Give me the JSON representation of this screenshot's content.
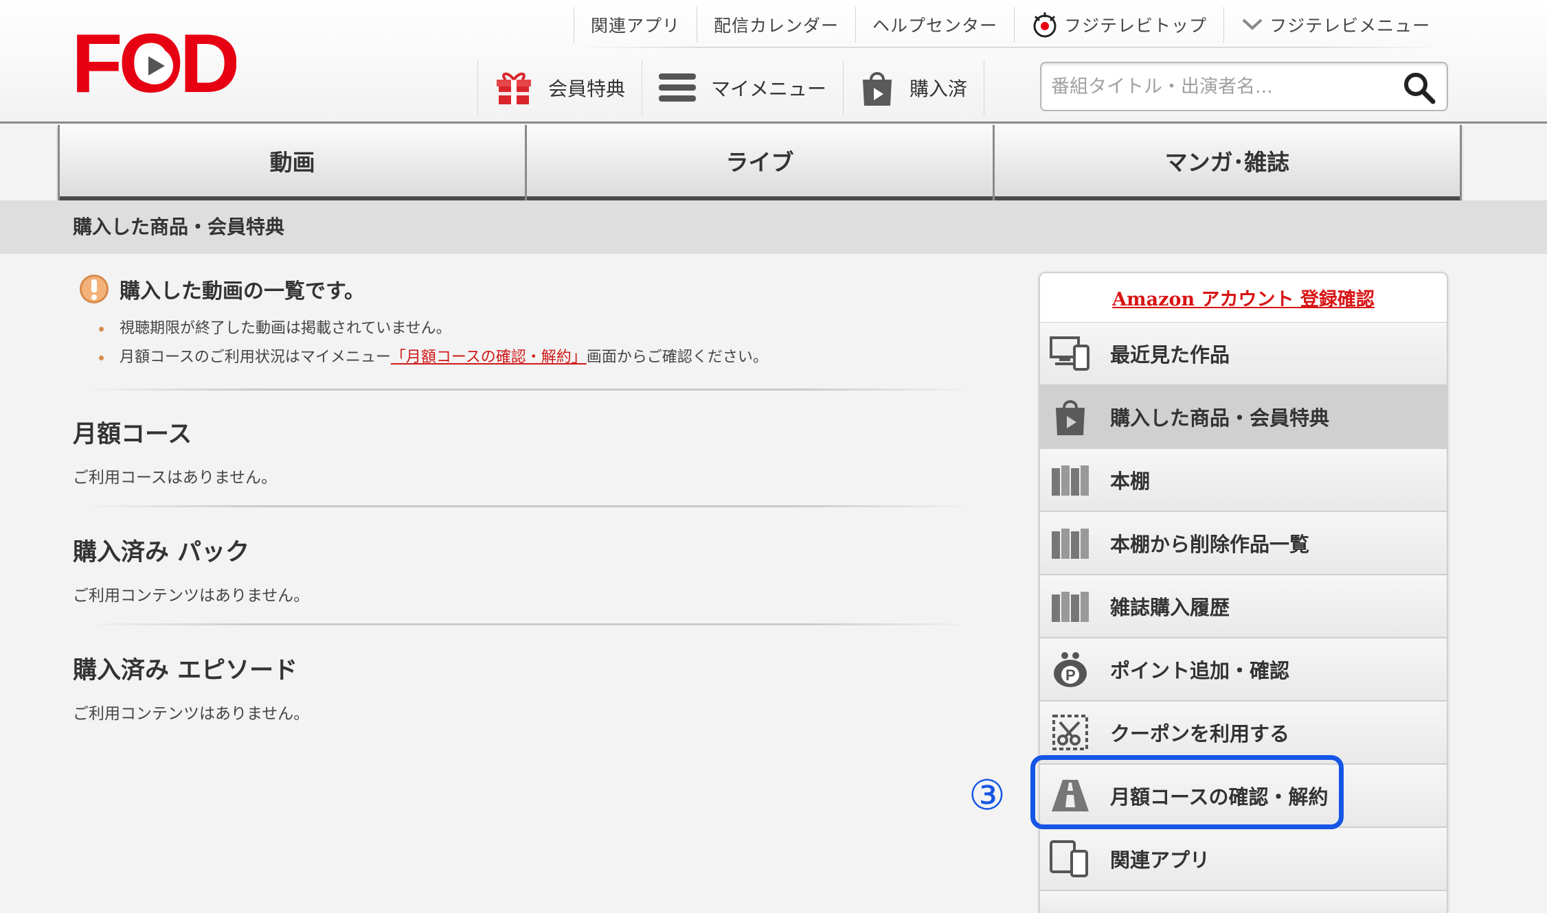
{
  "logo": {
    "text": "FOD"
  },
  "util_nav": [
    {
      "label": "関連アプリ"
    },
    {
      "label": "配信カレンダー"
    },
    {
      "label": "ヘルプセンター"
    },
    {
      "label": "フジテレビトップ",
      "icon": "fujitv-eye-icon"
    },
    {
      "label": "フジテレビメニュー",
      "icon": "chevron-down-icon"
    }
  ],
  "main_nav": [
    {
      "label": "会員特典",
      "icon": "gift-icon"
    },
    {
      "label": "マイメニュー",
      "icon": "hamburger-icon"
    },
    {
      "label": "購入済",
      "icon": "shopping-bag-play-icon"
    }
  ],
  "search": {
    "placeholder": "番組タイトル・出演者名..."
  },
  "tabs": [
    {
      "label": "動画"
    },
    {
      "label": "ライブ"
    },
    {
      "label": "マンガ･雑誌"
    }
  ],
  "breadcrumb": "購入した商品・会員特典",
  "notice": {
    "title": "購入した動画の一覧です。",
    "line1": "視聴期限が終了した動画は掲載されていません。",
    "line2_prefix": "月額コースのご利用状況はマイメニュー",
    "line2_link": "「月額コースの確認・解約」",
    "line2_suffix": "画面からご確認ください。"
  },
  "sections": [
    {
      "title": "月額コース",
      "text": "ご利用コースはありません。"
    },
    {
      "title": "購入済み パック",
      "text": "ご利用コンテンツはありません。"
    },
    {
      "title": "購入済み エピソード",
      "text": "ご利用コンテンツはありません。"
    }
  ],
  "side_menu": {
    "header_link": "Amazon アカウント 登録確認",
    "items": [
      {
        "label": "最近見た作品",
        "icon": "devices-icon"
      },
      {
        "label": "購入した商品・会員特典",
        "icon": "shopping-bag-play-icon",
        "active": true
      },
      {
        "label": "本棚",
        "icon": "bookshelf-icon"
      },
      {
        "label": "本棚から削除作品一覧",
        "icon": "bookshelf-icon"
      },
      {
        "label": "雑誌購入履歴",
        "icon": "bookshelf-icon"
      },
      {
        "label": "ポイント追加・確認",
        "icon": "point-purse-icon"
      },
      {
        "label": "クーポンを利用する",
        "icon": "coupon-scissors-icon"
      },
      {
        "label": "月額コースの確認・解約",
        "icon": "road-icon"
      },
      {
        "label": "関連アプリ",
        "icon": "devices-icon"
      }
    ]
  },
  "annotation": {
    "number": "③",
    "color": "#1556e6"
  },
  "colors": {
    "brand_red": "#e60012",
    "link_red": "#d81414"
  }
}
